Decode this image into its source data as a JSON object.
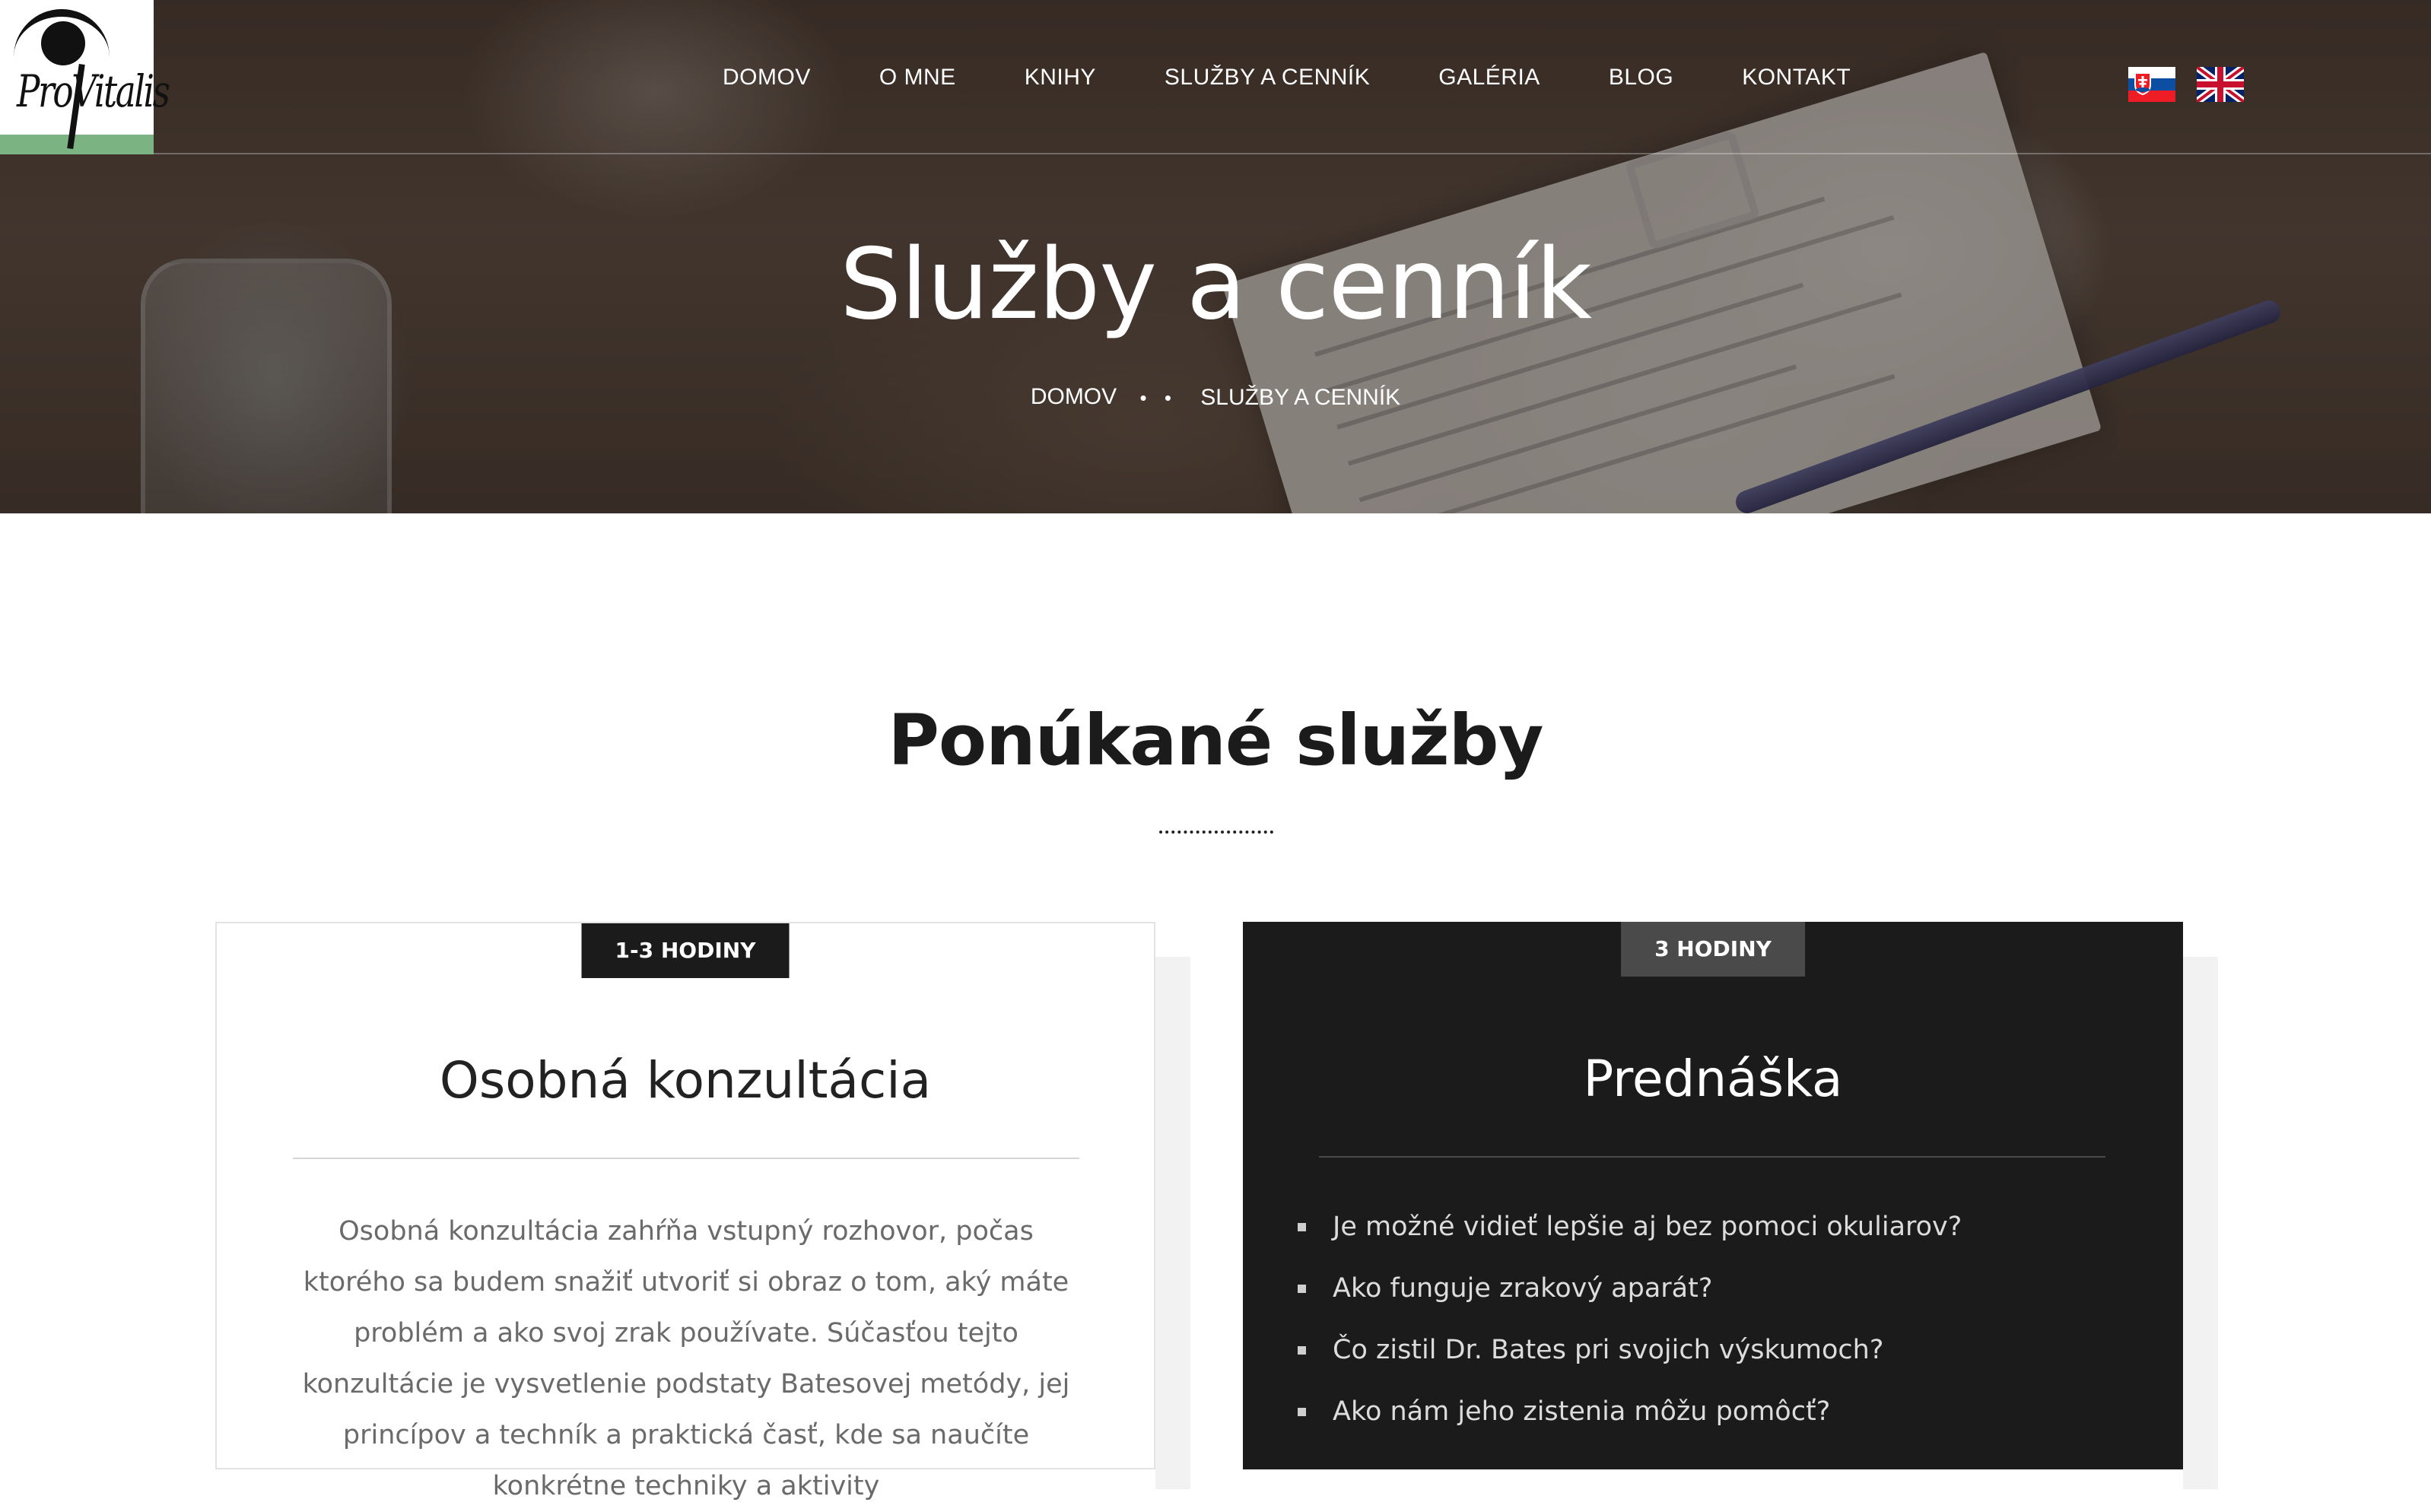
{
  "header": {
    "logo_text": "ProVitalis",
    "nav": [
      {
        "label": "DOMOV"
      },
      {
        "label": "O MNE"
      },
      {
        "label": "KNIHY"
      },
      {
        "label": "SLUŽBY A CENNÍK"
      },
      {
        "label": "GALÉRIA"
      },
      {
        "label": "BLOG"
      },
      {
        "label": "KONTAKT"
      }
    ],
    "languages": [
      {
        "code": "sk",
        "icon": "slovak-flag-icon"
      },
      {
        "code": "en",
        "icon": "uk-flag-icon"
      }
    ]
  },
  "hero": {
    "title": "Služby a cenník",
    "breadcrumb": {
      "home": "DOMOV",
      "separator": "• •",
      "current": "SLUŽBY A CENNÍK"
    }
  },
  "section": {
    "title": "Ponúkané služby"
  },
  "cards": [
    {
      "badge": "1-3 HODINY",
      "title": "Osobná konzultácia",
      "text": "Osobná konzultácia zahŕňa vstupný rozhovor, počas ktorého sa budem snažiť utvoriť si obraz o tom, aký máte problém a ako svoj zrak používate. Súčasťou tejto konzultácie je vysvetlenie podstaty Batesovej metódy, jej princípov a techník a praktická časť, kde sa naučíte konkrétne techniky a aktivity"
    },
    {
      "badge": "3 HODINY",
      "title": "Prednáška",
      "items": [
        "Je možné vidieť lepšie aj bez pomoci okuliarov?",
        "Ako funguje zrakový aparát?",
        "Čo zistil Dr. Bates pri svojich výskumoch?",
        "Ako nám jeho zistenia môžu pomôcť?"
      ]
    }
  ],
  "colors": {
    "accent_green": "#7bb482",
    "dark_card": "#1b1b1b",
    "badge_dark": "#1b1b1b",
    "badge_gray": "#4a4a4a"
  }
}
